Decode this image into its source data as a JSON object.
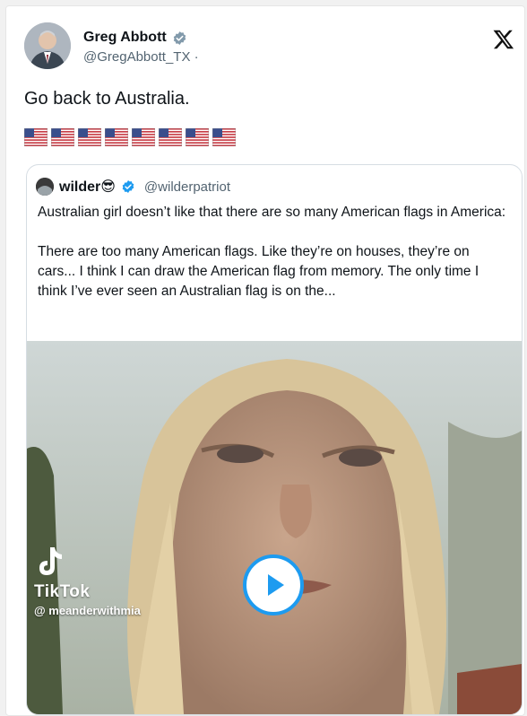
{
  "author": {
    "name": "Greg Abbott",
    "handle": "@GregAbbott_TX",
    "separator": "·",
    "avatar_icon": "profile-photo-icon",
    "verified_icon": "verified-badge-icon"
  },
  "tweet": {
    "text": "Go back to Australia.",
    "flag_emoji_count": 8,
    "flag_icon": "us-flag-emoji"
  },
  "quoted": {
    "name": "wilder",
    "name_emoji": "😎",
    "handle": "@wilderpatriot",
    "verified_color": "#1d9bf0",
    "text_line1": "Australian girl doesn’t like that there are so many American flags in America:",
    "text_line2": "There are too many American flags. Like they’re on houses, they’re on cars... I think I can draw the American flag from memory. The only time I think I’ve ever seen an Australian flag is on the..."
  },
  "video": {
    "watermark_brand": "TikTok",
    "watermark_user": "@ meanderwithmia",
    "play_button_color": "#1d9bf0"
  },
  "logo": {
    "icon": "x-logo-icon"
  }
}
